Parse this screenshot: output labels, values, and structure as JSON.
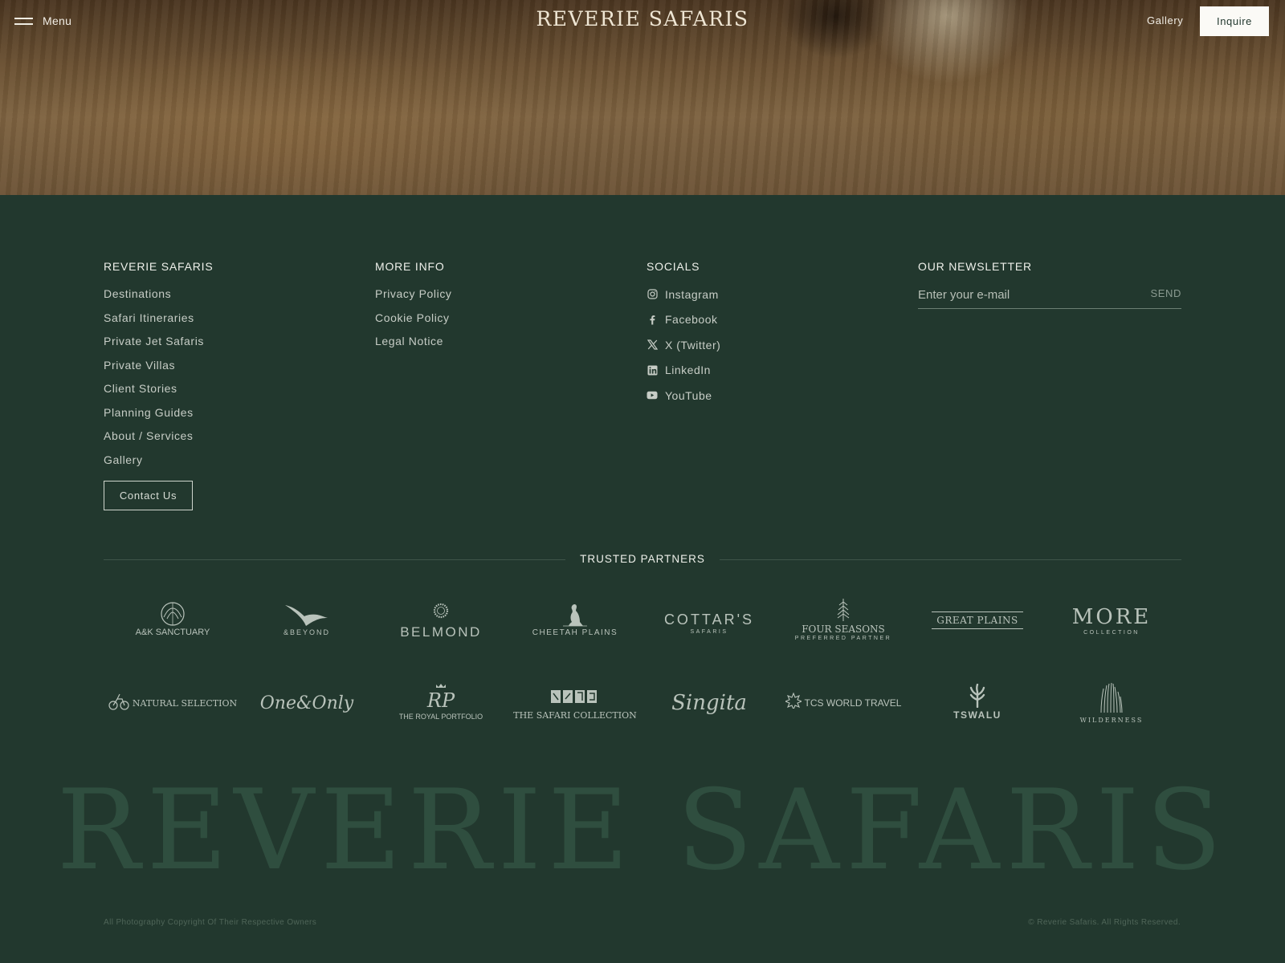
{
  "header": {
    "menu_label": "Menu",
    "brand": "REVERIE SAFARIS",
    "gallery_label": "Gallery",
    "inquire_label": "Inquire"
  },
  "footer": {
    "brand_col": {
      "title": "REVERIE SAFARIS",
      "links": [
        "Destinations",
        "Safari Itineraries",
        "Private Jet Safaris",
        "Private Villas",
        "Client Stories",
        "Planning Guides",
        "About / Services",
        "Gallery"
      ],
      "contact_label": "Contact Us"
    },
    "info_col": {
      "title": "MORE INFO",
      "links": [
        "Privacy Policy",
        "Cookie Policy",
        "Legal Notice"
      ]
    },
    "socials_col": {
      "title": "SOCIALS",
      "items": [
        {
          "label": "Instagram",
          "icon": "instagram-icon"
        },
        {
          "label": "Facebook",
          "icon": "facebook-icon"
        },
        {
          "label": "X (Twitter)",
          "icon": "x-twitter-icon"
        },
        {
          "label": "LinkedIn",
          "icon": "linkedin-icon"
        },
        {
          "label": "YouTube",
          "icon": "youtube-icon"
        }
      ]
    },
    "newsletter": {
      "title": "OUR NEWSLETTER",
      "placeholder": "Enter your e-mail",
      "send_label": "SEND"
    }
  },
  "partners": {
    "title": "TRUSTED PARTNERS",
    "logos": [
      {
        "name": "A&K SANCTUARY"
      },
      {
        "name": "&BEYOND"
      },
      {
        "name": "BELMOND"
      },
      {
        "name": "CHEETAH PLAINS"
      },
      {
        "name": "COTTAR'S",
        "sub": "SAFARIS"
      },
      {
        "name": "FOUR SEASONS",
        "sub": "PREFERRED PARTNER"
      },
      {
        "name": "GREAT PLAINS"
      },
      {
        "name": "MORE",
        "sub": "COLLECTION"
      },
      {
        "name": "NATURAL SELECTION"
      },
      {
        "name": "One&Only"
      },
      {
        "name": "THE ROYAL PORTFOLIO"
      },
      {
        "name": "THE SAFARI COLLECTION"
      },
      {
        "name": "Singita"
      },
      {
        "name": "TCS WORLD TRAVEL"
      },
      {
        "name": "TSWALU"
      },
      {
        "name": "WILDERNESS"
      }
    ]
  },
  "wordmark": "REVERIE SAFARIS",
  "legal": {
    "photo_credit": "All Photography Copyright Of Their Respective Owners",
    "copyright": "© Reverie Safaris. All Rights Reserved."
  },
  "colors": {
    "footer_bg": "#22382e",
    "wordmark": "#2f4e3f",
    "inquire_bg": "#fbfaf6"
  }
}
